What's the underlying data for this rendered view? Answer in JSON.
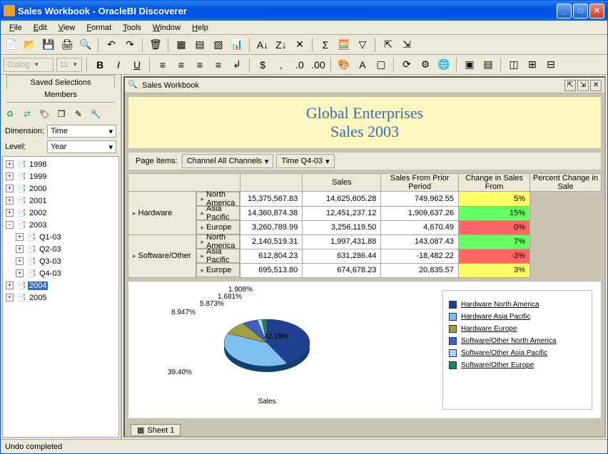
{
  "window": {
    "title": "Sales Workbook - OracleBI Discoverer"
  },
  "menu": [
    "File",
    "Edit",
    "View",
    "Format",
    "Tools",
    "Window",
    "Help"
  ],
  "format": {
    "font": "Dialog",
    "size": "11"
  },
  "sidebar": {
    "tab": "Saved Selections",
    "members": "Members",
    "dim_label": "Dimension:",
    "dim_value": "Time",
    "lvl_label": "Level:",
    "lvl_value": "Year",
    "selected": "2004"
  },
  "tree": [
    {
      "lvl": 0,
      "exp": "+",
      "label": "1998"
    },
    {
      "lvl": 0,
      "exp": "+",
      "label": "1999"
    },
    {
      "lvl": 0,
      "exp": "+",
      "label": "2000"
    },
    {
      "lvl": 0,
      "exp": "+",
      "label": "2001"
    },
    {
      "lvl": 0,
      "exp": "+",
      "label": "2002"
    },
    {
      "lvl": 0,
      "exp": "-",
      "label": "2003"
    },
    {
      "lvl": 1,
      "exp": "+",
      "label": "Q1-03"
    },
    {
      "lvl": 1,
      "exp": "+",
      "label": "Q2-03"
    },
    {
      "lvl": 1,
      "exp": "+",
      "label": "Q3-03"
    },
    {
      "lvl": 1,
      "exp": "+",
      "label": "Q4-03"
    },
    {
      "lvl": 0,
      "exp": "+",
      "label": "2004"
    },
    {
      "lvl": 0,
      "exp": "+",
      "label": "2005"
    }
  ],
  "content": {
    "tab": "Sales Workbook",
    "title1": "Global Enterprises",
    "title2": "Sales 2003",
    "page_items": "Page Items:",
    "pi1": "Channel  All Channels",
    "pi2": "Time  Q4-03",
    "sheet": "Sheet 1"
  },
  "colhdr": [
    "Sales",
    "Sales From Prior Period",
    "Change in Sales From",
    "Percent Change in Sale"
  ],
  "rows": [
    {
      "g": "Hardware",
      "r": "North America",
      "v": [
        "15,375,567.83",
        "14,625,605.28",
        "749,962.55",
        "5%"
      ],
      "c": "yellow"
    },
    {
      "g": "Hardware",
      "r": "Asia Pacific",
      "v": [
        "14,360,874.38",
        "12,451,237.12",
        "1,909,637.26",
        "15%"
      ],
      "c": "green"
    },
    {
      "g": "Hardware",
      "r": "Europe",
      "v": [
        "3,260,789.99",
        "3,256,119.50",
        "4,670.49",
        "0%"
      ],
      "c": "red"
    },
    {
      "g": "Software/Other",
      "r": "North America",
      "v": [
        "2,140,519.31",
        "1,997,431.88",
        "143,087.43",
        "7%"
      ],
      "c": "green"
    },
    {
      "g": "Software/Other",
      "r": "Asia Pacific",
      "v": [
        "612,804.23",
        "631,286.44",
        "-18,482.22",
        "-3%"
      ],
      "c": "red"
    },
    {
      "g": "Software/Other",
      "r": "Europe",
      "v": [
        "695,513.80",
        "674,678.23",
        "20,835.57",
        "3%"
      ],
      "c": "yellow"
    }
  ],
  "chart_data": {
    "type": "pie",
    "title": "Sales",
    "series": [
      {
        "name": "Hardware North America",
        "value": 42.19,
        "color": "#204090"
      },
      {
        "name": "Hardware Asia Pacific",
        "value": 39.4,
        "color": "#80c0f0"
      },
      {
        "name": "Hardware Europe",
        "value": 8.947,
        "color": "#a0a040"
      },
      {
        "name": "Software/Other North America",
        "value": 5.873,
        "color": "#4060c0"
      },
      {
        "name": "Software/Other Asia Pacific",
        "value": 1.681,
        "color": "#a0d8ff"
      },
      {
        "name": "Software/Other Europe",
        "value": 1.908,
        "color": "#208060"
      }
    ]
  },
  "status": "Undo completed"
}
